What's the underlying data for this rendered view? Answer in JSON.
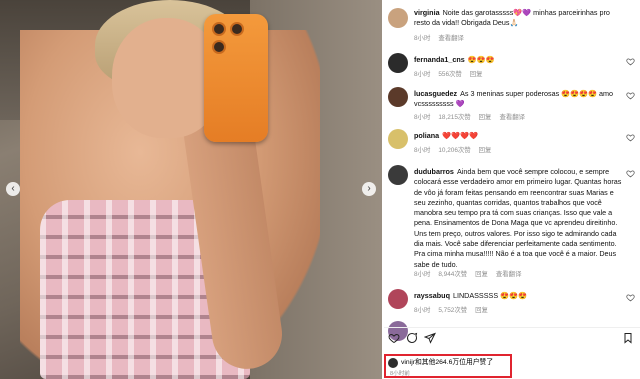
{
  "photo": {
    "alt_icons": {
      "left_arrow": "chevron-left-icon",
      "right_arrow": "chevron-right-icon"
    },
    "left_arrow_glyph": "‹",
    "right_arrow_glyph": "›"
  },
  "comments": [
    {
      "username": "virginia",
      "text": "Noite das garotasssss💖💜 minhas parceirinhas pro resto da vida!! Obrigada Deus🙏🏻",
      "time": "8小时",
      "translate": "查看翻译",
      "likes": "",
      "reply": "",
      "avatar_color": "#c9a27e"
    },
    {
      "username": "fernanda1_cns",
      "text": "😍😍😍",
      "time": "8小时",
      "translate": "",
      "likes": "556次赞",
      "reply": "回复",
      "avatar_color": "#2b2b2b"
    },
    {
      "username": "lucasguedez",
      "text": "As 3 meninas super poderosas 😍😍😍😍 amo vcsssssssss 💜",
      "time": "8小时",
      "translate": "查看翻译",
      "likes": "18,215次赞",
      "reply": "回复",
      "avatar_color": "#5b3a2a"
    },
    {
      "username": "poliana",
      "text": "❤️❤️❤️❤️",
      "time": "8小时",
      "translate": "",
      "likes": "10,206次赞",
      "reply": "回复",
      "avatar_color": "#d8c06a"
    },
    {
      "username": "dudubarros",
      "text": "Ainda bem que você sempre colocou, e sempre colocará esse verdadeiro amor em primeiro lugar. Quantas horas de vôo já foram feitas pensando em reencontrar suas Marias e seu zezinho, quantas corridas, quantos trabalhos que você manobra seu tempo pra tá com suas crianças. Isso que vale a pena. Ensinamentos de Dona Maga que vc aprendeu direitinho. Uns tem preço, outros valores. Por isso sigo te admirando cada dia mais. Você sabe diferenciar perfeitamente cada sentimento. Pra cima minha musa!!!!! Não é a toa que você é a maior. Deus sabe de tudo.",
      "time": "8小时",
      "translate": "查看翻译",
      "likes": "8,944次赞",
      "reply": "回复",
      "avatar_color": "#3a3a3a"
    },
    {
      "username": "rayssabuq",
      "text": "LINDASSSSS 😍😍😍",
      "time": "8小时",
      "translate": "",
      "likes": "5,752次赞",
      "reply": "回复",
      "avatar_color": "#b0455a"
    },
    {
      "username": "",
      "text": "",
      "time": "",
      "translate": "",
      "likes": "",
      "reply": "",
      "avatar_color": "#8a6a9a"
    }
  ],
  "likes_summary": {
    "text": "vinijr和其他264.6万位用户赞了",
    "time": "8小时前",
    "avatar_color": "#2d2d2d",
    "highlight_color": "#e0242f"
  },
  "icons": [
    "heart-icon",
    "comment-icon",
    "share-icon",
    "bookmark-icon"
  ]
}
